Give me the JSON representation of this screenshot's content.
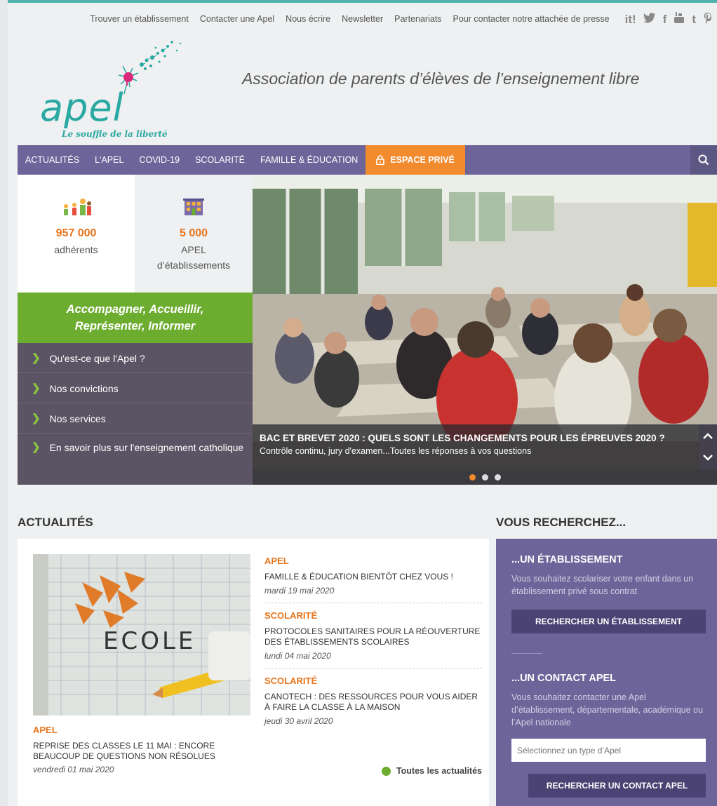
{
  "topbar": {
    "links": [
      "Trouver un établissement",
      "Contacter une Apel",
      "Nous écrire",
      "Newsletter",
      "Partenariats",
      "Pour contacter notre attachée de presse"
    ],
    "social_icons": [
      "scoopit-icon",
      "twitter-icon",
      "facebook-icon",
      "youtube-icon",
      "tumblr-icon",
      "pinterest-icon"
    ]
  },
  "header": {
    "logo_text": "apel",
    "logo_tagline": "Le souffle de la liberté",
    "tagline": "Association de parents d’élèves de l’enseignement libre"
  },
  "nav": {
    "items": [
      "Actualités",
      "L'Apel",
      "COVID-19",
      "Scolarité",
      "Famille & Éducation"
    ],
    "private_label": "ESPACE PRIVÉ"
  },
  "stats": [
    {
      "number": "957 000",
      "label": "adhérents"
    },
    {
      "number": "5 000",
      "label_1": "APEL",
      "label_2": "d’établissements"
    }
  ],
  "mission": {
    "line1": "Accompagner, Accueillir,",
    "line2": "Représenter, Informer"
  },
  "side_links": [
    "Qu'est-ce que l'Apel ?",
    "Nos convictions",
    "Nos services",
    "En savoir plus sur l'enseignement catholique"
  ],
  "hero": {
    "title": "BAC ET BREVET 2020 : QUELS SONT LES CHANGEMENTS POUR LES ÉPREUVES 2020 ?",
    "subtitle": "Contrôle continu, jury d'examen...Toutes les réponses à vos questions",
    "slides": 3,
    "active_slide": 1
  },
  "news": {
    "heading": "ACTUALITÉS",
    "image_text": "ECOLE",
    "main": {
      "category": "APEL",
      "title": "Reprise des classes le 11 mai : encore beaucoup de questions non résolues",
      "date": "vendredi 01 mai 2020"
    },
    "list": [
      {
        "category": "APEL",
        "title": "Famille & Éducation bientôt chez vous !",
        "date": "mardi 19 mai 2020"
      },
      {
        "category": "SCOLARITÉ",
        "title": "Protocoles sanitaires pour la réouverture des établissements scolaires",
        "date": "lundi 04 mai 2020"
      },
      {
        "category": "SCOLARITÉ",
        "title": "Canotech : des ressources pour vous aider à faire la classe à la maison",
        "date": "jeudi 30 avril 2020"
      }
    ],
    "all_label": "Toutes les actualités"
  },
  "search": {
    "heading": "VOUS RECHERCHEZ...",
    "school": {
      "title": "...UN ÉTABLISSEMENT",
      "text": "Vous souhaitez scolariser votre enfant dans un établissement privé sous contrat",
      "button": "Rechercher un établissement"
    },
    "contact": {
      "title": "...UN CONTACT APEL",
      "text": "Vous souhaitez contacter une Apel d’établissement, départementale, académique ou l’Apel nationale",
      "placeholder": "Sélectionnez un type d’Apel",
      "button": "Rechercher un contact Apel"
    }
  },
  "colors": {
    "nav": "#6d6599",
    "accent": "#f28a2e",
    "green": "#6cad2f",
    "teal": "#2aa9a2"
  }
}
